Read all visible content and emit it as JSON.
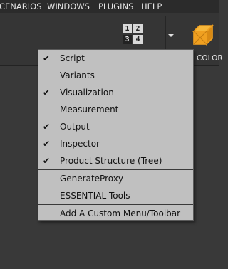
{
  "menubar": {
    "items": [
      "CENARIOS",
      "WINDOWS",
      "PLUGINS",
      "HELP"
    ]
  },
  "toolbar": {
    "viewport_layout": [
      "1",
      "2",
      "3",
      "4"
    ],
    "color_label": "COLOR"
  },
  "context_menu": {
    "groups": [
      [
        {
          "label": "Script",
          "checked": true
        },
        {
          "label": "Variants",
          "checked": false
        },
        {
          "label": "Visualization",
          "checked": true
        },
        {
          "label": "Measurement",
          "checked": false
        },
        {
          "label": "Output",
          "checked": true
        },
        {
          "label": "Inspector",
          "checked": true
        },
        {
          "label": "Product Structure (Tree)",
          "checked": true
        }
      ],
      [
        {
          "label": "GenerateProxy",
          "checked": false
        },
        {
          "label": "ESSENTIAL Tools",
          "checked": false
        }
      ],
      [
        {
          "label": "Add A Custom Menu/Toolbar",
          "checked": false
        }
      ]
    ],
    "check_glyph": "✔"
  },
  "icons": {
    "cube": "wireframe-cube-icon",
    "grid": "viewport-grid-icon",
    "dropdown": "chevron-down-icon"
  },
  "colors": {
    "menu_bg": "#c0c0c0",
    "app_bg": "#393939",
    "cube_orange": "#f0a020"
  }
}
